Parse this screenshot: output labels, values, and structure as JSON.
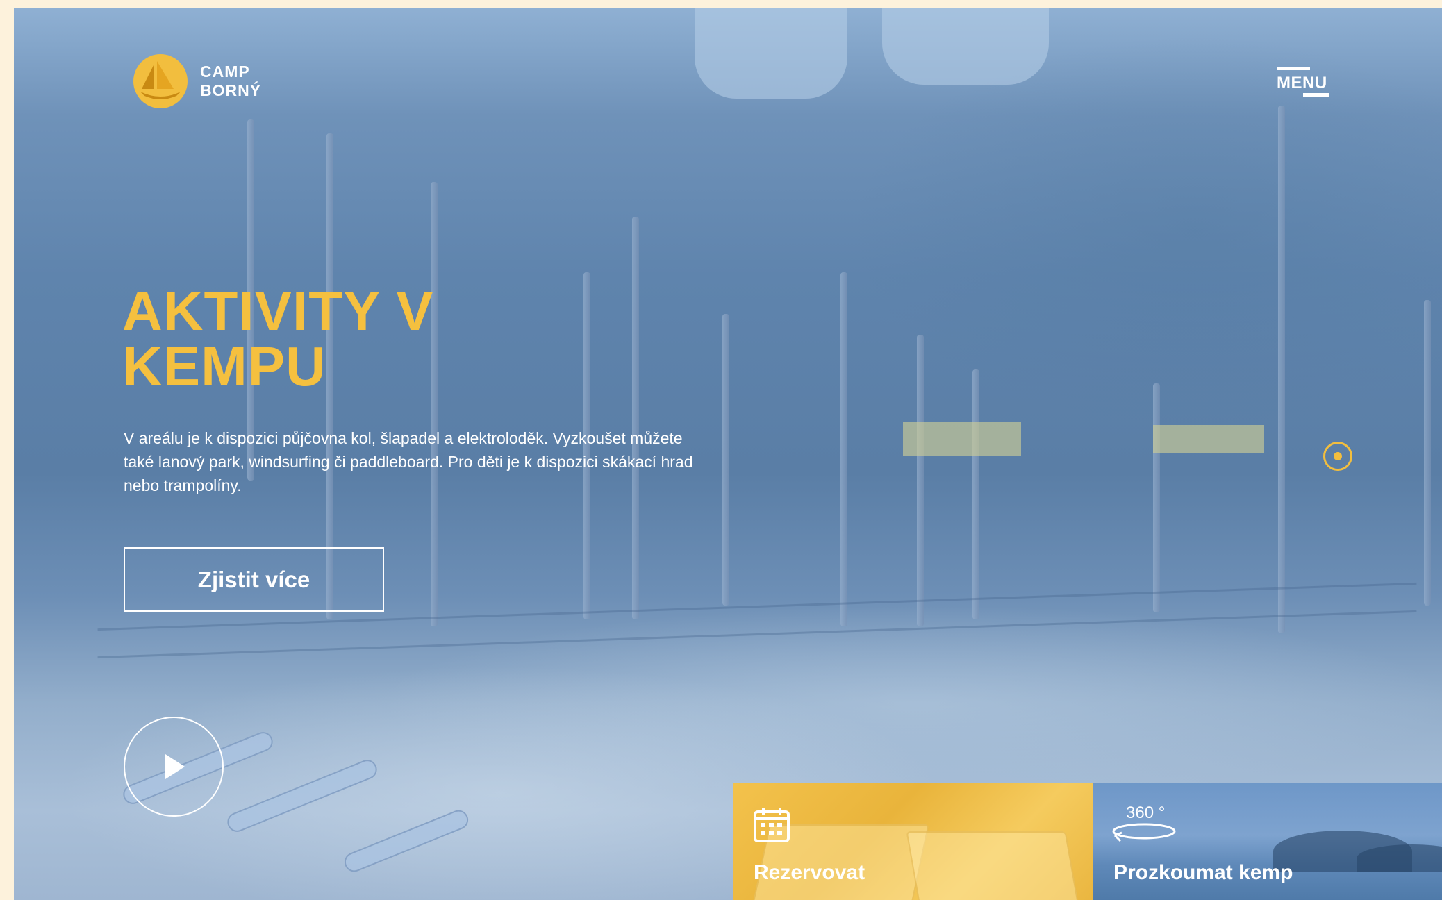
{
  "brand": {
    "line1": "CAMP",
    "line2": "BORNÝ",
    "accent_color": "#f2be3e",
    "logo_icon": "sailboat-logo-icon"
  },
  "header": {
    "menu_label": "MENU",
    "menu_icon": "hamburger-icon"
  },
  "hero": {
    "title_line1": "AKTIVITY V",
    "title_line2": "KEMPU",
    "description": "V areálu je k dispozici půjčovna kol, šlapadel a elektroloděk. Vyzkoušet můžete také lanový park, windsurfing či paddleboard. Pro děti je k dispozici skákací hrad nebo trampolíny.",
    "cta_label": "Zjistit více",
    "play_icon": "play-icon",
    "hotspot_icon": "location-hotspot-icon"
  },
  "tiles": {
    "reserve": {
      "label": "Rezervovat",
      "icon": "calendar-icon",
      "bg_color": "#f2be3e"
    },
    "explore": {
      "label": "Prozkoumat kemp",
      "degree_label": "360 °",
      "icon": "rotate-360-icon"
    }
  }
}
